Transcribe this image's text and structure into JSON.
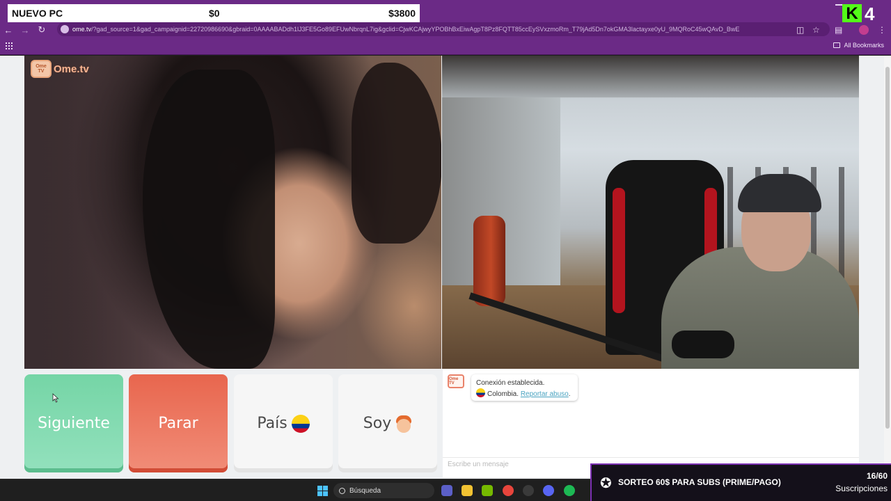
{
  "overlay": {
    "goal_title": "NUEVO PC",
    "goal_current": "$0",
    "goal_target": "$3800",
    "channel_badge": "4"
  },
  "browser": {
    "url_domain": "ome.tv",
    "url_rest": "/?gad_source=1&gad_campaignid=22720986690&gbraid=0AAAABADdh1lJ3FE5Go89EFUwNbrqnL7ig&gclid=CjwKCAjwyYPOBhBxEiwAgpT8Pz8FQTT85ccEySVxzmoRm_T79jAd5Dn7okGMA3lactayxe0yU_9MQRoC45wQAvD_BwE",
    "all_bookmarks": "All Bookmarks"
  },
  "site": {
    "logo_tv": "Ome TV",
    "logo_text": "Ome.tv"
  },
  "controls": {
    "next_label": "Siguiente",
    "stop_label": "Parar",
    "country_label": "País",
    "gender_label": "Soy"
  },
  "chat": {
    "avatar_label": "Ome TV",
    "status": "Conexión establecida.",
    "country": "Colombia.",
    "report_link": "Reportar abuso",
    "input_placeholder": "Escribe un mensaje"
  },
  "taskbar": {
    "search_label": "Búsqueda"
  },
  "promo": {
    "text": "SORTEO 60$ PARA SUBS (PRIME/PAGO)",
    "count": "16/60",
    "label": "Suscripciones"
  },
  "colors": {
    "browser_purple": "#6b2a86",
    "next_green": "#75d5a6",
    "stop_red": "#e8664e",
    "kick_green": "#53fc18"
  }
}
